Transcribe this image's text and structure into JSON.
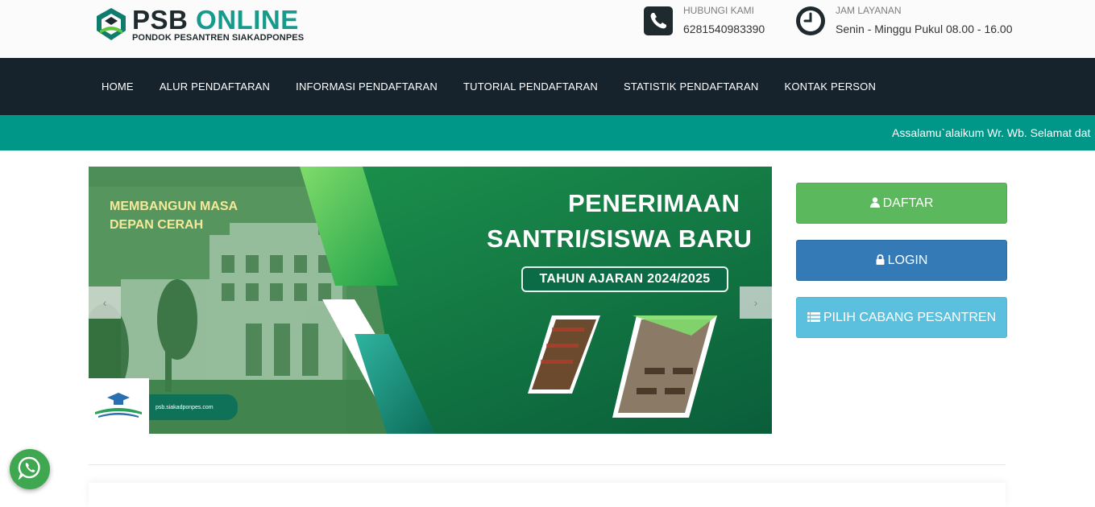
{
  "brand": {
    "title_main": "PSB ",
    "title_accent": "ONLINE",
    "subtitle": "PONDOK PESANTREN SIAKADPONPES"
  },
  "contact": {
    "phone_label": "HUBUNGI KAMI",
    "phone_value": "6281540983390",
    "hours_label": "JAM LAYANAN",
    "hours_value": "Senin - Minggu Pukul 08.00 - 16.00"
  },
  "nav": {
    "items": [
      {
        "label": "HOME"
      },
      {
        "label": "ALUR PENDAFTARAN"
      },
      {
        "label": "INFORMASI PENDAFTARAN"
      },
      {
        "label": "TUTORIAL PENDAFTARAN"
      },
      {
        "label": "STATISTIK PENDAFTARAN"
      },
      {
        "label": "KONTAK PERSON"
      }
    ]
  },
  "ticker": {
    "text": "Assalamu`alaikum Wr. Wb. Selamat dat"
  },
  "slide": {
    "tagline_1": "MEMBANGUN MASA",
    "tagline_2": "DEPAN CERAH",
    "heading_1": "PENERIMAAN",
    "heading_2": "SANTRI/SISWA BARU",
    "year": "TAHUN AJARAN 2024/2025",
    "url": "psb.siakadponpes.com",
    "prev_symbol": "‹",
    "next_symbol": "›"
  },
  "actions": {
    "daftar_label": "DAFTAR",
    "login_label": "LOGIN",
    "cabang_label": "PILIH CABANG PESANTREN"
  },
  "colors": {
    "nav_bg": "#16222c",
    "ticker_bg": "#009688",
    "brand_accent": "#169a8c",
    "success": "#5cb85c",
    "primary": "#337ab7",
    "info": "#5bc0de",
    "whatsapp": "#3fa74f"
  },
  "icons": {
    "phone": "phone-icon",
    "clock": "clock-icon",
    "user": "user-icon",
    "lock": "lock-icon",
    "list": "list-icon",
    "whatsapp": "whatsapp-icon"
  }
}
